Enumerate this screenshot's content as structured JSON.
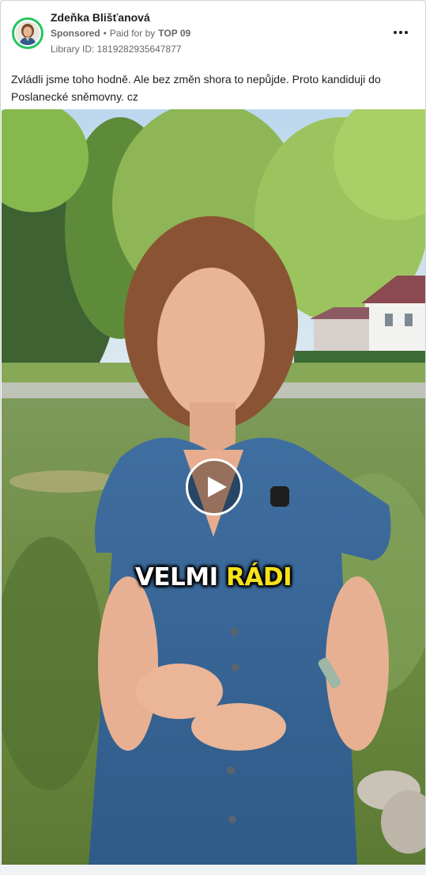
{
  "header": {
    "page_name": "Zdeňka Blišťanová",
    "sponsored_label": "Sponsored",
    "separator": "•",
    "paid_for_prefix": "Paid for by",
    "payer": "TOP 09",
    "library_id": "Library ID: 1819282935647877",
    "more_icon": "more-horizontal-icon"
  },
  "ad": {
    "text": "Zvládli jsme toho hodně. Ale bez změn shora to nepůjde. Proto kandiduji do Poslanecké sněmovny. cz"
  },
  "video": {
    "caption_white": "VELMI",
    "caption_yellow": "RÁDI",
    "play_icon": "play-icon",
    "colors": {
      "caption_yellow": "#f6e21b",
      "avatar_ring": "#23c55e",
      "dress": "#3b6a9c"
    }
  }
}
